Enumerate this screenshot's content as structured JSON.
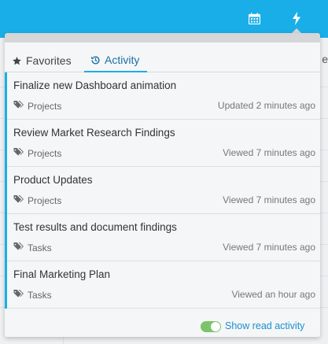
{
  "header": {
    "icons": [
      "calendar-icon",
      "bolt-icon"
    ],
    "accent": "#1aaee8"
  },
  "background": {
    "partial_text": "e"
  },
  "tabs": [
    {
      "label": "Favorites",
      "icon": "star-icon",
      "active": false
    },
    {
      "label": "Activity",
      "icon": "history-icon",
      "active": true
    }
  ],
  "items": [
    {
      "title": "Finalize new Dashboard animation",
      "tag": "Projects",
      "status": "Updated 2 minutes ago"
    },
    {
      "title": "Review Market Research Findings",
      "tag": "Projects",
      "status": "Viewed 7 minutes ago"
    },
    {
      "title": "Product Updates",
      "tag": "Projects",
      "status": "Viewed 7 minutes ago"
    },
    {
      "title": "Test results and document findings",
      "tag": "Tasks",
      "status": "Viewed 7 minutes ago"
    },
    {
      "title": "Final Marketing Plan",
      "tag": "Tasks",
      "status": "Viewed an hour ago"
    }
  ],
  "footer": {
    "toggle_on": true,
    "label": "Show read activity",
    "toggle_color": "#7cc46a"
  }
}
